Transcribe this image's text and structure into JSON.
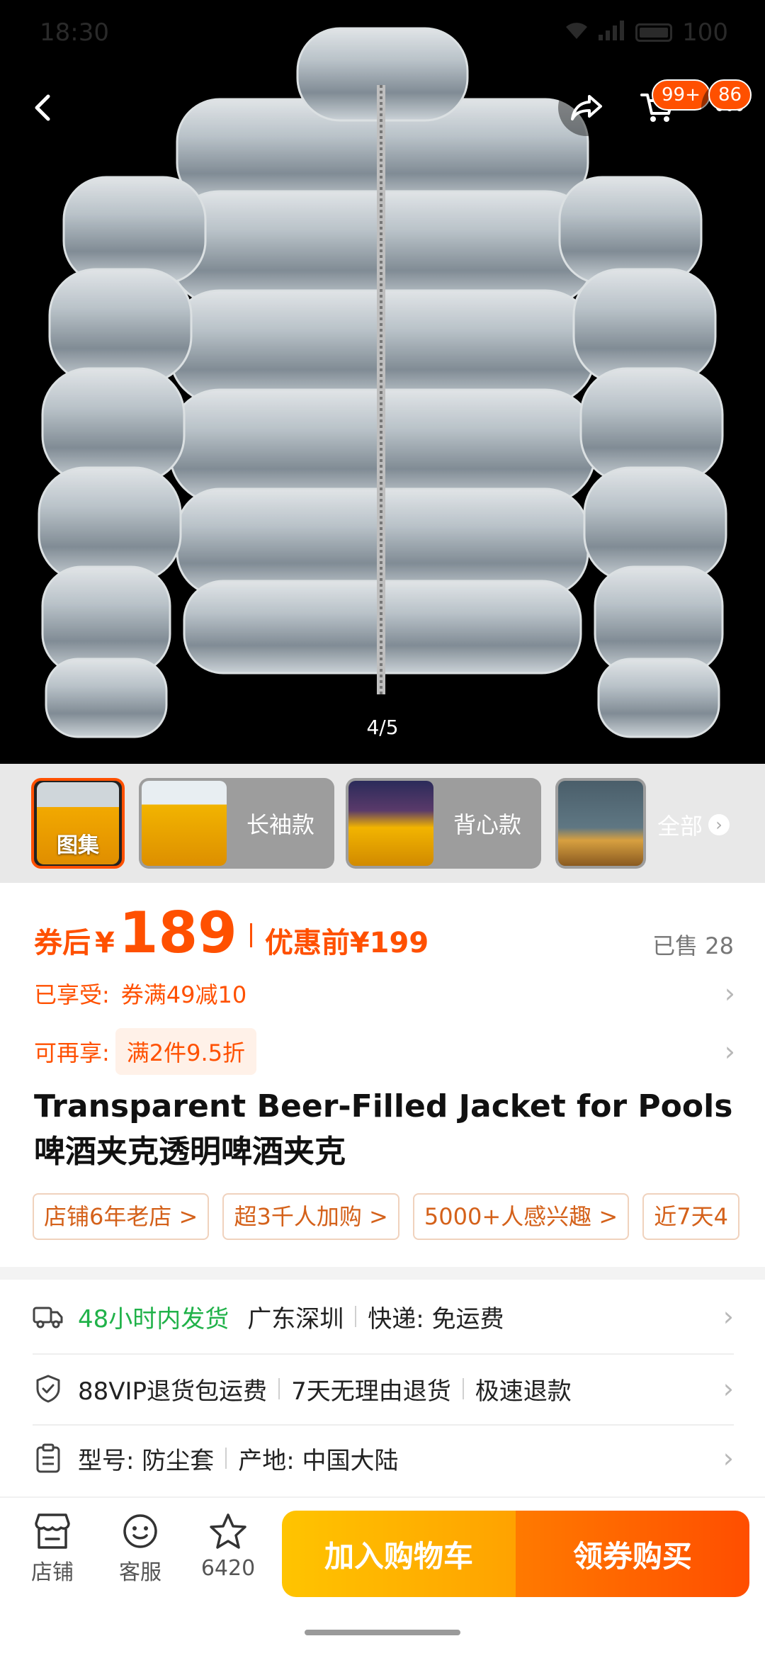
{
  "status_bar": {
    "time": "18:30",
    "battery": "100"
  },
  "header": {
    "cart_badge": "99+",
    "message_badge": "86"
  },
  "gallery": {
    "page_indicator": "4/5",
    "thumbnails": [
      {
        "label": "图集"
      },
      {
        "label": "长袖款"
      },
      {
        "label": "背心款"
      },
      {
        "label": ""
      }
    ],
    "all_label": "全部"
  },
  "price": {
    "prefix": "券后",
    "currency": "¥",
    "value": "189",
    "before_label": "优惠前¥199",
    "sold": "已售 28"
  },
  "promotions": {
    "applied_label": "已享受:",
    "applied_value": "券满49减10",
    "extra_label": "可再享:",
    "extra_value": "满2件9.5折"
  },
  "product": {
    "title": "Transparent Beer-Filled Jacket for Pools啤酒夹克透明啤酒夹克"
  },
  "tags": [
    "店铺6年老店 >",
    "超3千人加购 >",
    "5000+人感兴趣 >",
    "近7天4"
  ],
  "services": {
    "shipping_time": "48小时内发货",
    "origin": "广东深圳",
    "delivery": "快递: 免运费",
    "vip": "88VIP退货包运费",
    "no_reason": "7天无理由退货",
    "fast_refund": "极速退款",
    "model": "型号: 防尘套",
    "place": "产地: 中国大陆"
  },
  "bottom_bar": {
    "shop": "店铺",
    "service": "客服",
    "favorites": "6420",
    "add_to_cart": "加入购物车",
    "buy": "领券购买"
  },
  "colors": {
    "accent": "#ff5000",
    "cart_button": "#ffb400",
    "green": "#21b24a"
  }
}
